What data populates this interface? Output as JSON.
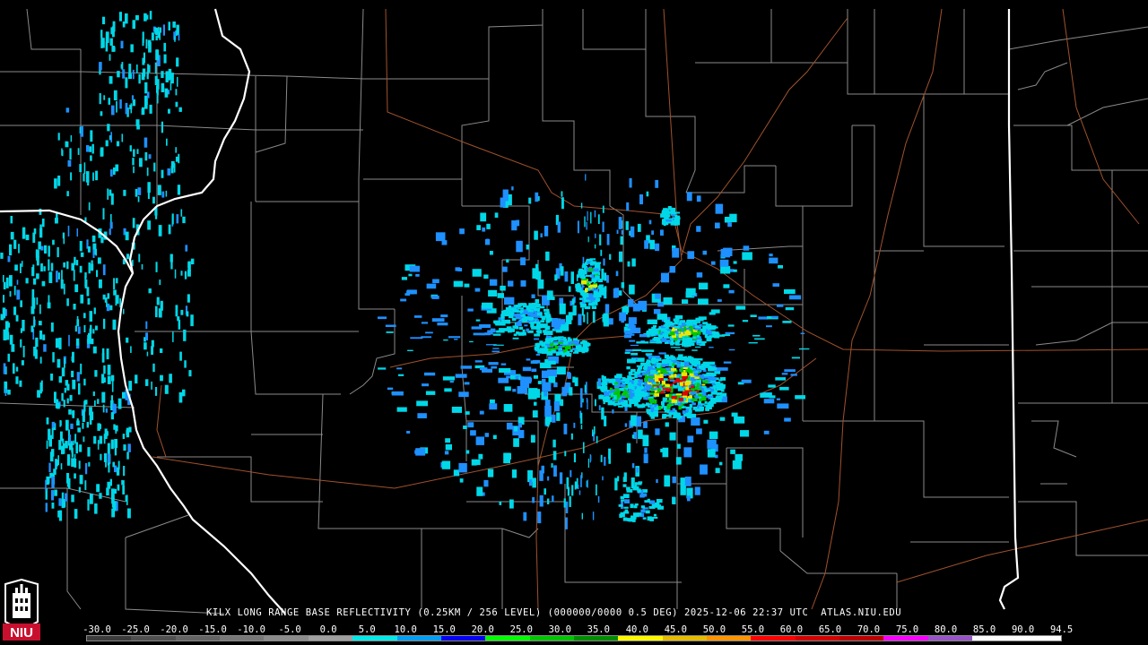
{
  "product": {
    "caption": "KILX LONG RANGE BASE REFLECTIVITY (0.25KM / 256 LEVEL) (000000/0000 0.5 DEG) 2025-12-06 22:37 UTC  ATLAS.NIU.EDU"
  },
  "scale": {
    "labels": [
      "-30.0",
      "-25.0",
      "-20.0",
      "-15.0",
      "-10.0",
      "-5.0",
      "0.0",
      "5.0",
      "10.0",
      "15.0",
      "20.0",
      "25.0",
      "30.0",
      "35.0",
      "40.0",
      "45.0",
      "50.0",
      "55.0",
      "60.0",
      "65.0",
      "70.0",
      "75.0",
      "80.0",
      "85.0",
      "90.0",
      "94.5"
    ],
    "colors": [
      "#3c3c3c",
      "#505050",
      "#646464",
      "#787878",
      "#8c8c8c",
      "#a0a0a0",
      "#04e9e7",
      "#019ff4",
      "#0300f4",
      "#02fd02",
      "#01c501",
      "#008e00",
      "#fdf802",
      "#e5bc00",
      "#fd9500",
      "#fd0000",
      "#d40000",
      "#bc0000",
      "#f800fd",
      "#9854c6",
      "#fdfdfd",
      "#ffffff"
    ]
  },
  "logo": {
    "text": "NIU",
    "colors": {
      "red": "#c8102e",
      "white": "#ffffff"
    }
  },
  "map": {
    "colors": {
      "state_border": "#ffffff",
      "county_border": "#8a8a8a",
      "highway": "#a0522d",
      "echo_light": "#00d8e8",
      "echo_mid": "#1e90ff",
      "echo_green": "#00c800",
      "echo_yellow": "#e8e800",
      "echo_red": "#e00000"
    },
    "echo_regions": [
      {
        "name": "west-band",
        "intensity": "light"
      },
      {
        "name": "central-radar-ring",
        "intensity": "light"
      },
      {
        "name": "northeast-cell",
        "intensity": "moderate"
      },
      {
        "name": "southeast-cell",
        "intensity": "heavy"
      }
    ]
  }
}
